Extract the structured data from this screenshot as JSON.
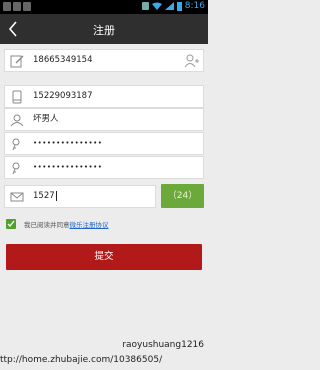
{
  "status_bar": {
    "time": "8:16"
  },
  "header": {
    "title": "注册",
    "back_icon": "chevron-left-icon"
  },
  "form": {
    "phone": {
      "value": "18665349154",
      "icon": "edit-icon",
      "action_icon": "add-contact-icon"
    },
    "phone2": {
      "value": "15229093187",
      "icon": "mobile-phone-icon"
    },
    "username": {
      "value": "坏男人",
      "icon": "user-icon"
    },
    "password": {
      "value": "•••••••••••••••",
      "icon": "key-icon"
    },
    "password_confirm": {
      "value": "•••••••••••••••",
      "icon": "key-icon"
    },
    "captcha": {
      "value": "1527",
      "icon": "sms-icon"
    },
    "captcha_button": "（24）"
  },
  "agreement": {
    "text": "我已阅读并同意",
    "link": "微乐注册协议",
    "checked": true
  },
  "submit_label": "提交",
  "watermark": {
    "line1": "raoyushuang1216",
    "line2": "ttp://home.zhubajie.com/10386505/"
  },
  "colors": {
    "accent_red": "#b21a1a",
    "accent_green": "#6aa93a",
    "titlebar": "#2f2f2f"
  }
}
